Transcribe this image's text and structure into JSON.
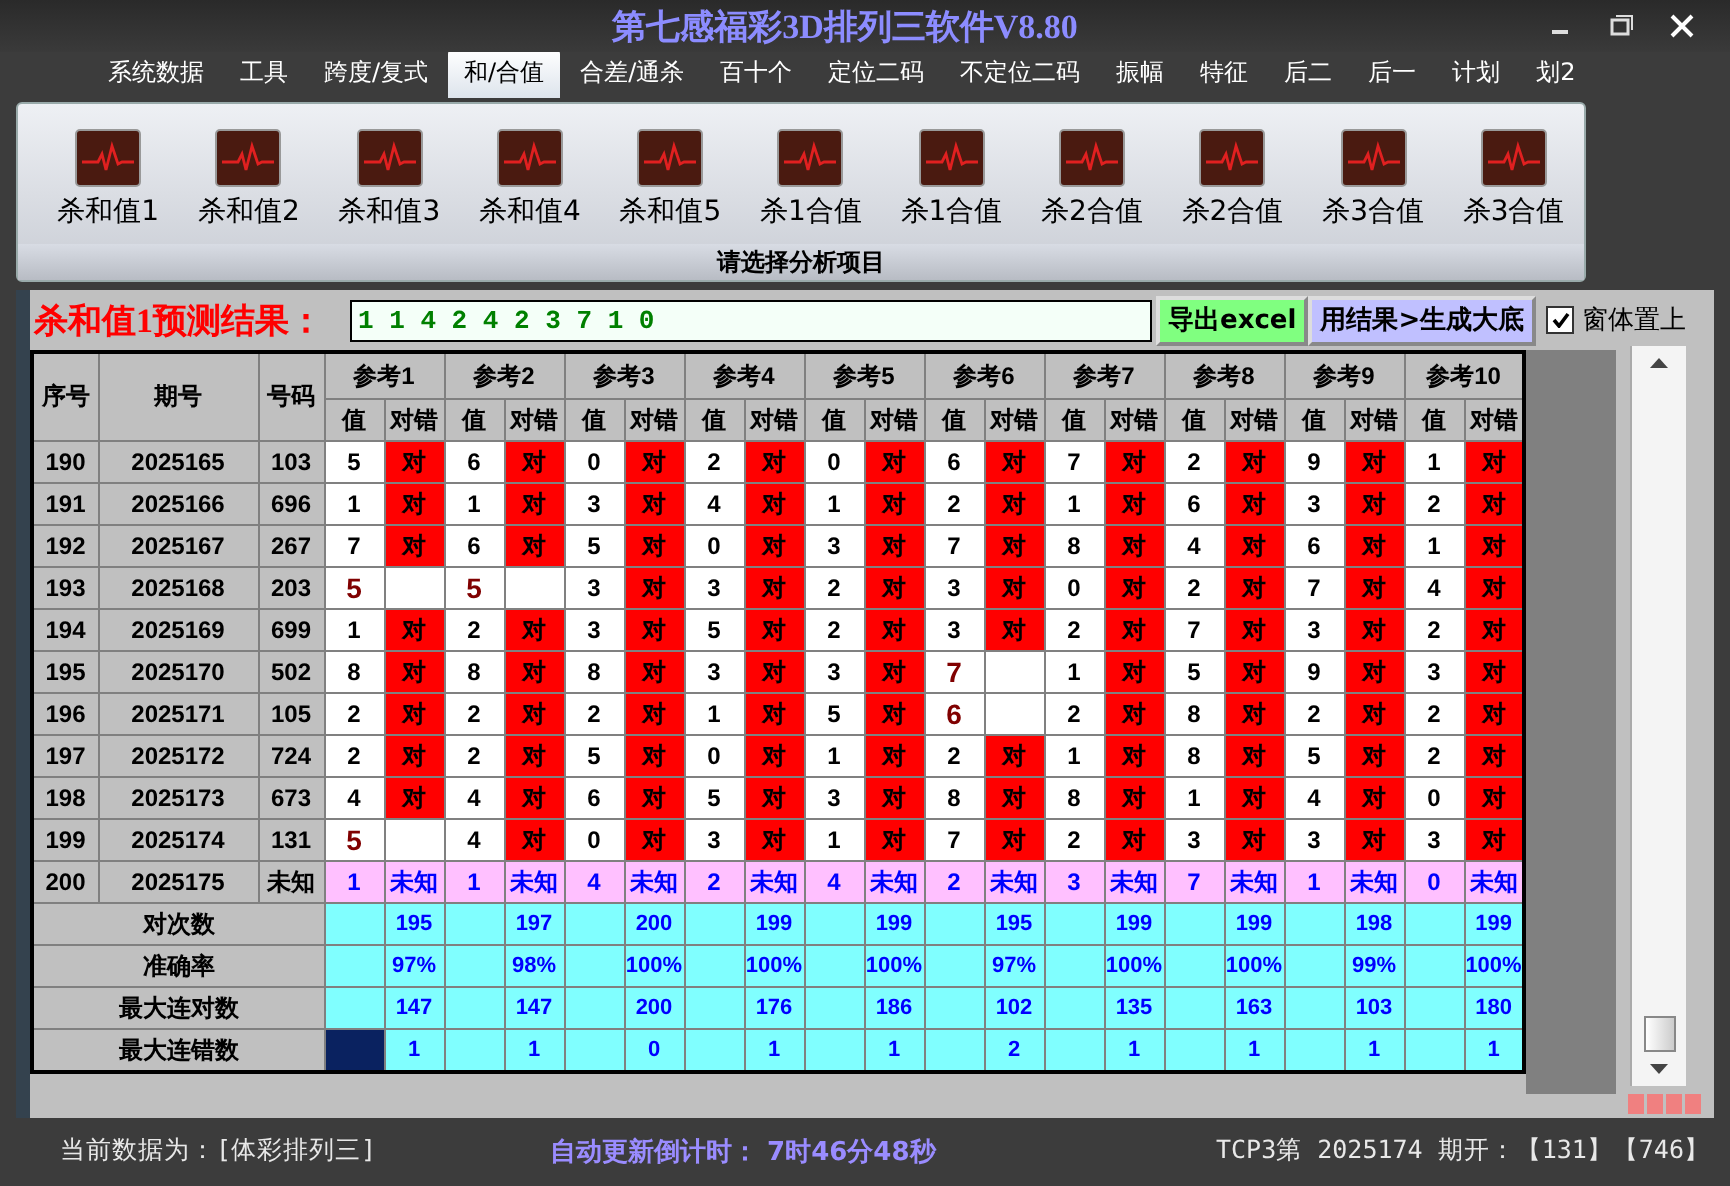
{
  "window": {
    "title": "第七感福彩3D排列三软件V8.80"
  },
  "menu": [
    {
      "label": "系统数据",
      "selected": false
    },
    {
      "label": "工具",
      "selected": false
    },
    {
      "label": "跨度/复式",
      "selected": false
    },
    {
      "label": "和/合值",
      "selected": true
    },
    {
      "label": "合差/通杀",
      "selected": false
    },
    {
      "label": "百十个",
      "selected": false
    },
    {
      "label": "定位二码",
      "selected": false
    },
    {
      "label": "不定位二码",
      "selected": false
    },
    {
      "label": "振幅",
      "selected": false
    },
    {
      "label": "特征",
      "selected": false
    },
    {
      "label": "后二",
      "selected": false
    },
    {
      "label": "后一",
      "selected": false
    },
    {
      "label": "计划",
      "selected": false
    },
    {
      "label": "划2",
      "selected": false
    }
  ],
  "ribbon": {
    "items": [
      "杀和值1",
      "杀和值2",
      "杀和值3",
      "杀和值4",
      "杀和值5",
      "杀1合值",
      "杀1合值",
      "杀2合值",
      "杀2合值",
      "杀3合值",
      "杀3合值"
    ],
    "group_caption": "请选择分析项目"
  },
  "result": {
    "label": "杀和值1预测结果：",
    "value": "1 1 4 2 4 2 3 7 1 0",
    "buttons": [
      "导出excel",
      "用结果>生成大底"
    ],
    "pin": {
      "label": "窗体置上",
      "checked": true
    }
  },
  "table": {
    "columns": [
      "序号",
      "期号",
      "号码"
    ],
    "refs": [
      {
        "label": "参考1",
        "value_header": "值",
        "result_header": "对错"
      },
      {
        "label": "参考2",
        "value_header": "值",
        "result_header": "对错"
      },
      {
        "label": "参考3",
        "value_header": "值",
        "result_header": "对错"
      },
      {
        "label": "参考4",
        "value_header": "值",
        "result_header": "对错"
      },
      {
        "label": "参考5",
        "value_header": "值",
        "result_header": "对错"
      },
      {
        "label": "参考6",
        "value_header": "值",
        "result_header": "对错"
      },
      {
        "label": "参考7",
        "value_header": "值",
        "result_header": "对错"
      },
      {
        "label": "参考8",
        "value_header": "值",
        "result_header": "对错"
      },
      {
        "label": "参考9",
        "value_header": "值",
        "result_header": "对错"
      },
      {
        "label": "参考10",
        "value_header": "值",
        "result_header": "对错"
      }
    ],
    "rows": [
      {
        "kind": "history",
        "seq": "190",
        "period": "2025165",
        "number": "103",
        "cells": [
          {
            "value": "5",
            "hit": true,
            "result": "对"
          },
          {
            "value": "6",
            "hit": true,
            "result": "对"
          },
          {
            "value": "0",
            "hit": true,
            "result": "对"
          },
          {
            "value": "2",
            "hit": true,
            "result": "对"
          },
          {
            "value": "0",
            "hit": true,
            "result": "对"
          },
          {
            "value": "6",
            "hit": true,
            "result": "对"
          },
          {
            "value": "7",
            "hit": true,
            "result": "对"
          },
          {
            "value": "2",
            "hit": true,
            "result": "对"
          },
          {
            "value": "9",
            "hit": true,
            "result": "对"
          },
          {
            "value": "1",
            "hit": true,
            "result": "对"
          }
        ]
      },
      {
        "kind": "history",
        "seq": "191",
        "period": "2025166",
        "number": "696",
        "cells": [
          {
            "value": "1",
            "hit": true,
            "result": "对"
          },
          {
            "value": "1",
            "hit": true,
            "result": "对"
          },
          {
            "value": "3",
            "hit": true,
            "result": "对"
          },
          {
            "value": "4",
            "hit": true,
            "result": "对"
          },
          {
            "value": "1",
            "hit": true,
            "result": "对"
          },
          {
            "value": "2",
            "hit": true,
            "result": "对"
          },
          {
            "value": "1",
            "hit": true,
            "result": "对"
          },
          {
            "value": "6",
            "hit": true,
            "result": "对"
          },
          {
            "value": "3",
            "hit": true,
            "result": "对"
          },
          {
            "value": "2",
            "hit": true,
            "result": "对"
          }
        ]
      },
      {
        "kind": "history",
        "seq": "192",
        "period": "2025167",
        "number": "267",
        "cells": [
          {
            "value": "7",
            "hit": true,
            "result": "对"
          },
          {
            "value": "6",
            "hit": true,
            "result": "对"
          },
          {
            "value": "5",
            "hit": true,
            "result": "对"
          },
          {
            "value": "0",
            "hit": true,
            "result": "对"
          },
          {
            "value": "3",
            "hit": true,
            "result": "对"
          },
          {
            "value": "7",
            "hit": true,
            "result": "对"
          },
          {
            "value": "8",
            "hit": true,
            "result": "对"
          },
          {
            "value": "4",
            "hit": true,
            "result": "对"
          },
          {
            "value": "6",
            "hit": true,
            "result": "对"
          },
          {
            "value": "1",
            "hit": true,
            "result": "对"
          }
        ]
      },
      {
        "kind": "history",
        "seq": "193",
        "period": "2025168",
        "number": "203",
        "cells": [
          {
            "value": "5",
            "hit": false
          },
          {
            "value": "5",
            "hit": false
          },
          {
            "value": "3",
            "hit": true,
            "result": "对"
          },
          {
            "value": "3",
            "hit": true,
            "result": "对"
          },
          {
            "value": "2",
            "hit": true,
            "result": "对"
          },
          {
            "value": "3",
            "hit": true,
            "result": "对"
          },
          {
            "value": "0",
            "hit": true,
            "result": "对"
          },
          {
            "value": "2",
            "hit": true,
            "result": "对"
          },
          {
            "value": "7",
            "hit": true,
            "result": "对"
          },
          {
            "value": "4",
            "hit": true,
            "result": "对"
          }
        ]
      },
      {
        "kind": "history",
        "seq": "194",
        "period": "2025169",
        "number": "699",
        "cells": [
          {
            "value": "1",
            "hit": true,
            "result": "对"
          },
          {
            "value": "2",
            "hit": true,
            "result": "对"
          },
          {
            "value": "3",
            "hit": true,
            "result": "对"
          },
          {
            "value": "5",
            "hit": true,
            "result": "对"
          },
          {
            "value": "2",
            "hit": true,
            "result": "对"
          },
          {
            "value": "3",
            "hit": true,
            "result": "对"
          },
          {
            "value": "2",
            "hit": true,
            "result": "对"
          },
          {
            "value": "7",
            "hit": true,
            "result": "对"
          },
          {
            "value": "3",
            "hit": true,
            "result": "对"
          },
          {
            "value": "2",
            "hit": true,
            "result": "对"
          }
        ]
      },
      {
        "kind": "history",
        "seq": "195",
        "period": "2025170",
        "number": "502",
        "cells": [
          {
            "value": "8",
            "hit": true,
            "result": "对"
          },
          {
            "value": "8",
            "hit": true,
            "result": "对"
          },
          {
            "value": "8",
            "hit": true,
            "result": "对"
          },
          {
            "value": "3",
            "hit": true,
            "result": "对"
          },
          {
            "value": "3",
            "hit": true,
            "result": "对"
          },
          {
            "value": "7",
            "hit": false
          },
          {
            "value": "1",
            "hit": true,
            "result": "对"
          },
          {
            "value": "5",
            "hit": true,
            "result": "对"
          },
          {
            "value": "9",
            "hit": true,
            "result": "对"
          },
          {
            "value": "3",
            "hit": true,
            "result": "对"
          }
        ]
      },
      {
        "kind": "history",
        "seq": "196",
        "period": "2025171",
        "number": "105",
        "cells": [
          {
            "value": "2",
            "hit": true,
            "result": "对"
          },
          {
            "value": "2",
            "hit": true,
            "result": "对"
          },
          {
            "value": "2",
            "hit": true,
            "result": "对"
          },
          {
            "value": "1",
            "hit": true,
            "result": "对"
          },
          {
            "value": "5",
            "hit": true,
            "result": "对"
          },
          {
            "value": "6",
            "hit": false
          },
          {
            "value": "2",
            "hit": true,
            "result": "对"
          },
          {
            "value": "8",
            "hit": true,
            "result": "对"
          },
          {
            "value": "2",
            "hit": true,
            "result": "对"
          },
          {
            "value": "2",
            "hit": true,
            "result": "对"
          }
        ]
      },
      {
        "kind": "history",
        "seq": "197",
        "period": "2025172",
        "number": "724",
        "cells": [
          {
            "value": "2",
            "hit": true,
            "result": "对"
          },
          {
            "value": "2",
            "hit": true,
            "result": "对"
          },
          {
            "value": "5",
            "hit": true,
            "result": "对"
          },
          {
            "value": "0",
            "hit": true,
            "result": "对"
          },
          {
            "value": "1",
            "hit": true,
            "result": "对"
          },
          {
            "value": "2",
            "hit": true,
            "result": "对"
          },
          {
            "value": "1",
            "hit": true,
            "result": "对"
          },
          {
            "value": "8",
            "hit": true,
            "result": "对"
          },
          {
            "value": "5",
            "hit": true,
            "result": "对"
          },
          {
            "value": "2",
            "hit": true,
            "result": "对"
          }
        ]
      },
      {
        "kind": "history",
        "seq": "198",
        "period": "2025173",
        "number": "673",
        "cells": [
          {
            "value": "4",
            "hit": true,
            "result": "对"
          },
          {
            "value": "4",
            "hit": true,
            "result": "对"
          },
          {
            "value": "6",
            "hit": true,
            "result": "对"
          },
          {
            "value": "5",
            "hit": true,
            "result": "对"
          },
          {
            "value": "3",
            "hit": true,
            "result": "对"
          },
          {
            "value": "8",
            "hit": true,
            "result": "对"
          },
          {
            "value": "8",
            "hit": true,
            "result": "对"
          },
          {
            "value": "1",
            "hit": true,
            "result": "对"
          },
          {
            "value": "4",
            "hit": true,
            "result": "对"
          },
          {
            "value": "0",
            "hit": true,
            "result": "对"
          }
        ]
      },
      {
        "kind": "history",
        "seq": "199",
        "period": "2025174",
        "number": "131",
        "cells": [
          {
            "value": "5",
            "hit": false
          },
          {
            "value": "4",
            "hit": true,
            "result": "对"
          },
          {
            "value": "0",
            "hit": true,
            "result": "对"
          },
          {
            "value": "3",
            "hit": true,
            "result": "对"
          },
          {
            "value": "1",
            "hit": true,
            "result": "对"
          },
          {
            "value": "7",
            "hit": true,
            "result": "对"
          },
          {
            "value": "2",
            "hit": true,
            "result": "对"
          },
          {
            "value": "3",
            "hit": true,
            "result": "对"
          },
          {
            "value": "3",
            "hit": true,
            "result": "对"
          },
          {
            "value": "3",
            "hit": true,
            "result": "对"
          }
        ]
      },
      {
        "kind": "forecast",
        "seq": "200",
        "period": "2025175",
        "number": "未知",
        "cells": [
          {
            "value": "1",
            "result": "未知"
          },
          {
            "value": "1",
            "result": "未知"
          },
          {
            "value": "4",
            "result": "未知"
          },
          {
            "value": "2",
            "result": "未知"
          },
          {
            "value": "4",
            "result": "未知"
          },
          {
            "value": "2",
            "result": "未知"
          },
          {
            "value": "3",
            "result": "未知"
          },
          {
            "value": "7",
            "result": "未知"
          },
          {
            "value": "1",
            "result": "未知"
          },
          {
            "value": "0",
            "result": "未知"
          }
        ]
      }
    ],
    "stats": [
      {
        "label": "对次数",
        "selected": false,
        "values": [
          "195",
          "197",
          "200",
          "199",
          "199",
          "195",
          "199",
          "199",
          "198",
          "199"
        ]
      },
      {
        "label": "准确率",
        "selected": false,
        "values": [
          "97%",
          "98%",
          "100%",
          "100%",
          "100%",
          "97%",
          "100%",
          "100%",
          "99%",
          "100%"
        ]
      },
      {
        "label": "最大连对数",
        "selected": false,
        "values": [
          "147",
          "147",
          "200",
          "176",
          "186",
          "102",
          "135",
          "163",
          "103",
          "180"
        ]
      },
      {
        "label": "最大连错数",
        "selected": true,
        "values": [
          "1",
          "1",
          "0",
          "1",
          "1",
          "2",
          "1",
          "1",
          "1",
          "1"
        ]
      }
    ]
  },
  "status_bar": {
    "source": "当前数据为：[体彩排列三]",
    "countdown": "自动更新倒计时： 7时46分48秒",
    "latest": "TCP3第 2025174 期开：【131】【746】"
  }
}
